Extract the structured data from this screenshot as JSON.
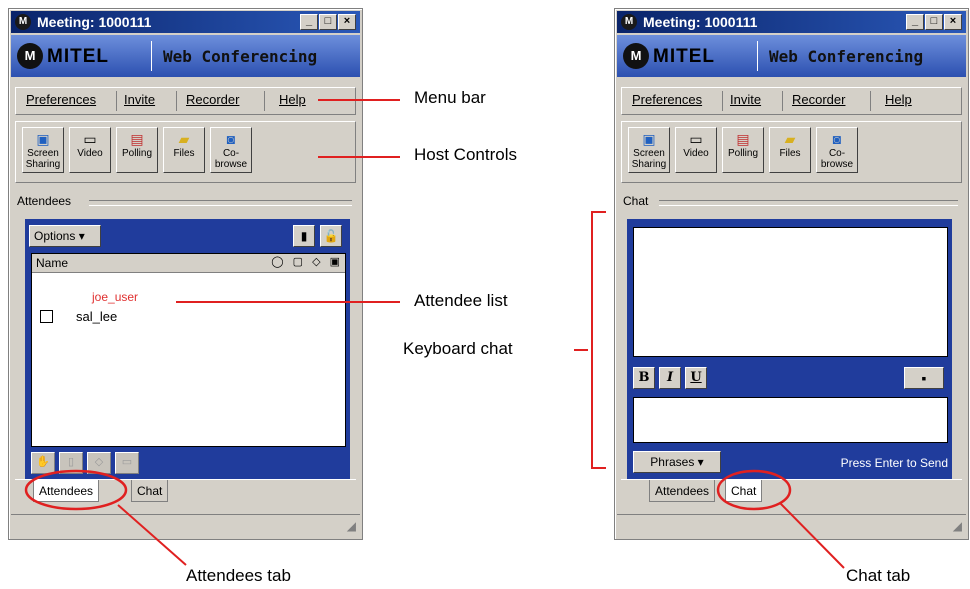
{
  "left_window": {
    "title": "Meeting: 1000111",
    "brand": "MITEL",
    "product": "Web Conferencing",
    "menu": [
      "Preferences",
      "Invite",
      "Recorder",
      "Help"
    ],
    "tools": [
      {
        "label": "Screen Sharing",
        "icon": "screen-sharing-icon"
      },
      {
        "label": "Video",
        "icon": "video-camera-icon"
      },
      {
        "label": "Polling",
        "icon": "polling-icon"
      },
      {
        "label": "Files",
        "icon": "files-icon"
      },
      {
        "label": "Co-browse",
        "icon": "co-browse-icon"
      }
    ],
    "section_label": "Attendees",
    "options_label": "Options",
    "list_header": "Name",
    "attendees": [
      "joe_user",
      "sal_lee"
    ],
    "tabs": [
      "Attendees",
      "Chat"
    ],
    "active_tab": "Attendees"
  },
  "right_window": {
    "title": "Meeting: 1000111",
    "brand": "MITEL",
    "product": "Web Conferencing",
    "menu": [
      "Preferences",
      "Invite",
      "Recorder",
      "Help"
    ],
    "section_label": "Chat",
    "format_buttons": [
      "B",
      "I",
      "U"
    ],
    "phrases_label": "Phrases",
    "send_hint": "Press Enter to Send",
    "tabs": [
      "Attendees",
      "Chat"
    ],
    "active_tab": "Chat"
  },
  "callouts": {
    "menu_bar": "Menu bar",
    "host_controls": "Host Controls",
    "attendee_list": "Attendee list",
    "keyboard_chat": "Keyboard chat",
    "attendees_tab": "Attendees tab",
    "chat_tab": "Chat tab"
  },
  "colors": {
    "panel_blue": "#203c9c",
    "callout_red": "#e02020",
    "titlebar": "#0a246a"
  }
}
